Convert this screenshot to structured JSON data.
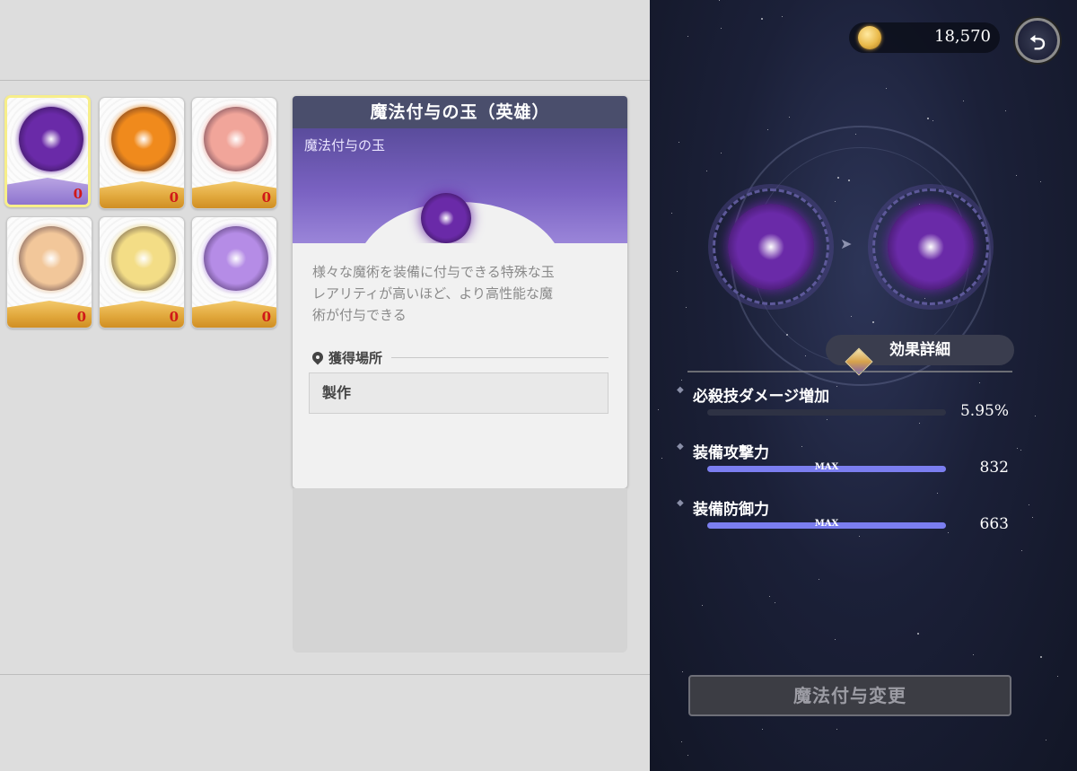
{
  "inventory": {
    "items": [
      {
        "name": "purple-orb",
        "count": "0",
        "color": "#6a2aa8",
        "band": "purple",
        "selected": true
      },
      {
        "name": "orange-orb",
        "count": "0",
        "color": "#f08a1c",
        "band": "gold",
        "selected": false
      },
      {
        "name": "pink-crystal-orb",
        "count": "0",
        "color": "#f1a59a",
        "band": "gold",
        "selected": false
      },
      {
        "name": "peach-crystal-orb",
        "count": "0",
        "color": "#f2c79a",
        "band": "gold",
        "selected": false
      },
      {
        "name": "gold-crystal-orb",
        "count": "0",
        "color": "#f3dd86",
        "band": "gold",
        "selected": false
      },
      {
        "name": "violet-crystal-orb",
        "count": "0",
        "color": "#b58ce6",
        "band": "gold",
        "selected": false
      }
    ]
  },
  "detail": {
    "title": "魔法付与の玉（英雄）",
    "subtitle": "魔法付与の玉",
    "description_line1": "様々な魔術を装備に付与できる特殊な玉",
    "description_line2": "レアリティが高いほど、より高性能な魔",
    "description_line3": "術が付与できる",
    "acquisition_heading": "獲得場所",
    "acquisition_value": "製作"
  },
  "currency": {
    "value": "18,570",
    "icon": "gold-coin-icon"
  },
  "back_button": {
    "icon": "return-arrow-icon",
    "glyph": "⮌"
  },
  "effect": {
    "tab_label": "効果詳細",
    "stats": [
      {
        "name": "必殺技ダメージ増加",
        "value": "5.95%",
        "fill": 0,
        "max_label": ""
      },
      {
        "name": "装備攻撃力",
        "value": "832",
        "fill": 1,
        "max_label": "MAX"
      },
      {
        "name": "装備防御力",
        "value": "663",
        "fill": 1,
        "max_label": "MAX"
      }
    ]
  },
  "change_button": {
    "label": "魔法付与変更"
  },
  "colors": {
    "accent_purple": "#7b7ef0",
    "count_red": "#d01818",
    "title_bar": "#4a4e6c"
  }
}
